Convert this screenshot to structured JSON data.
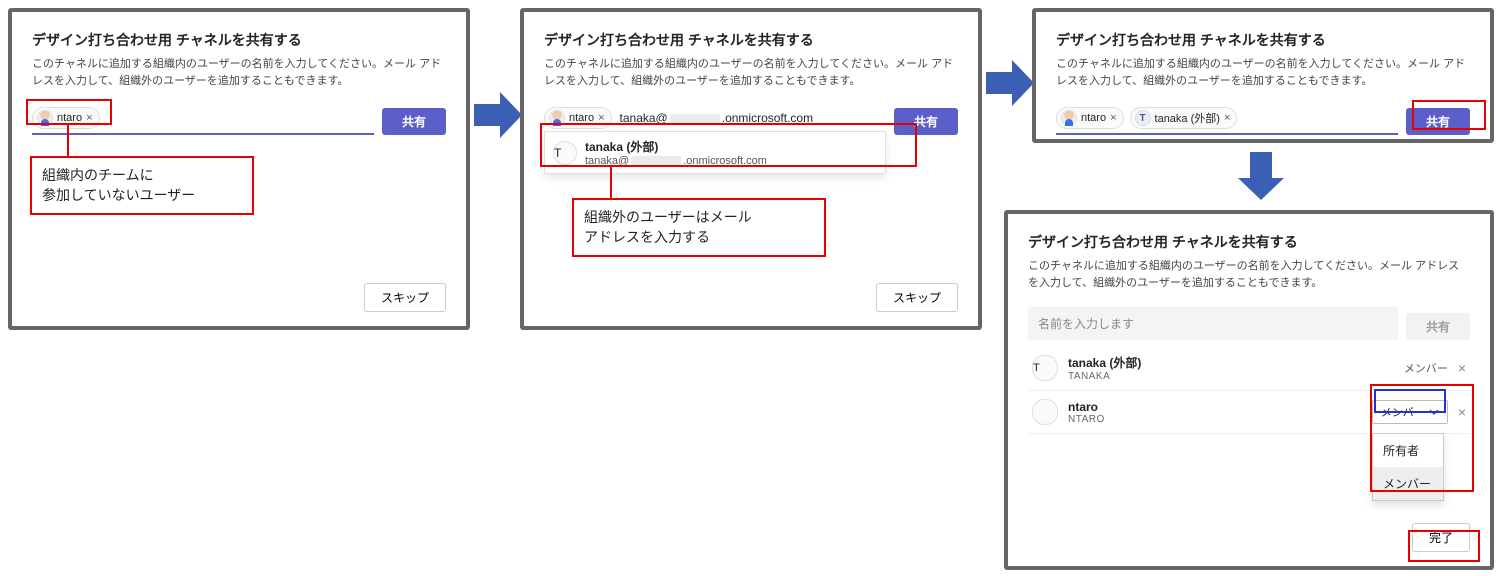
{
  "common": {
    "title": "デザイン打ち合わせ用 チャネルを共有する",
    "desc": "このチャネルに追加する組織内のユーザーの名前を入力してください。メール アドレスを入力して、組織外のユーザーを追加することもできます。",
    "share": "共有",
    "skip": "スキップ",
    "chip_x": "×"
  },
  "p1": {
    "chip": "ntaro",
    "callout_l1": "組織内のチームに",
    "callout_l2": "参加していないユーザー"
  },
  "p2": {
    "chip": "ntaro",
    "input_prefix": "tanaka@",
    "input_suffix": ".onmicrosoft.com",
    "suggest_name": "tanaka (外部)",
    "suggest_mail_prefix": "tanaka@",
    "suggest_mail_suffix": ".onmicrosoft.com",
    "avatar_letter": "T",
    "callout_l1": "組織外のユーザーはメール",
    "callout_l2": "アドレスを入力する"
  },
  "p3": {
    "chip1": "ntaro",
    "chip2": "tanaka (外部)",
    "avatar_letter": "T"
  },
  "p4": {
    "placeholder": "名前を入力します",
    "row1_name": "tanaka (外部)",
    "row1_sub": "TANAKA",
    "row1_role": "メンバー",
    "row1_avatar": "T",
    "row2_name": "ntaro",
    "row2_sub": "NTARO",
    "row2_role": "メンバー",
    "opt1": "所有者",
    "opt2": "メンバー",
    "done": "完了",
    "row_x": "×"
  }
}
